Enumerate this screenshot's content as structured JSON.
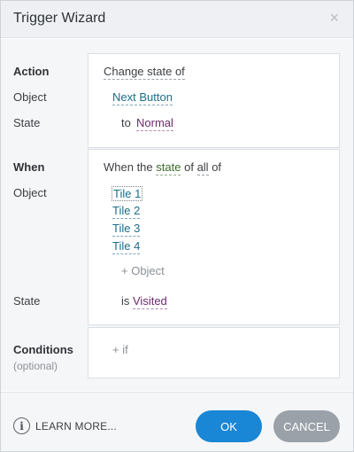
{
  "window": {
    "title": "Trigger Wizard",
    "close_glyph": "×"
  },
  "action_section": {
    "labels": {
      "action": "Action",
      "object": "Object",
      "state": "State"
    },
    "action_value": "Change state of",
    "object_value": "Next Button",
    "state_prefix": "to",
    "state_value": "Normal"
  },
  "when_section": {
    "labels": {
      "when": "When",
      "object": "Object",
      "state": "State"
    },
    "sentence": {
      "prefix": "When the",
      "keyword": "state",
      "middle": "of",
      "quantifier": "all",
      "suffix": "of"
    },
    "objects": [
      "Tile 1",
      "Tile 2",
      "Tile 3",
      "Tile 4"
    ],
    "add_object": "+ Object",
    "state_prefix": "is",
    "state_value": "Visited"
  },
  "conditions_section": {
    "label": "Conditions",
    "sublabel": "(optional)",
    "add_if": "+ if"
  },
  "footer": {
    "learn_more": "LEARN MORE...",
    "info_glyph": "i",
    "ok": "OK",
    "cancel": "CANCEL"
  },
  "colors": {
    "ok_button": "#1a86d6",
    "cancel_button": "#9aa1a8",
    "link": "#1b6f8a",
    "state_value": "#6a2b6b",
    "keyword": "#3d6b2a"
  },
  "icons": {
    "close": "close-icon",
    "info": "info-icon"
  }
}
